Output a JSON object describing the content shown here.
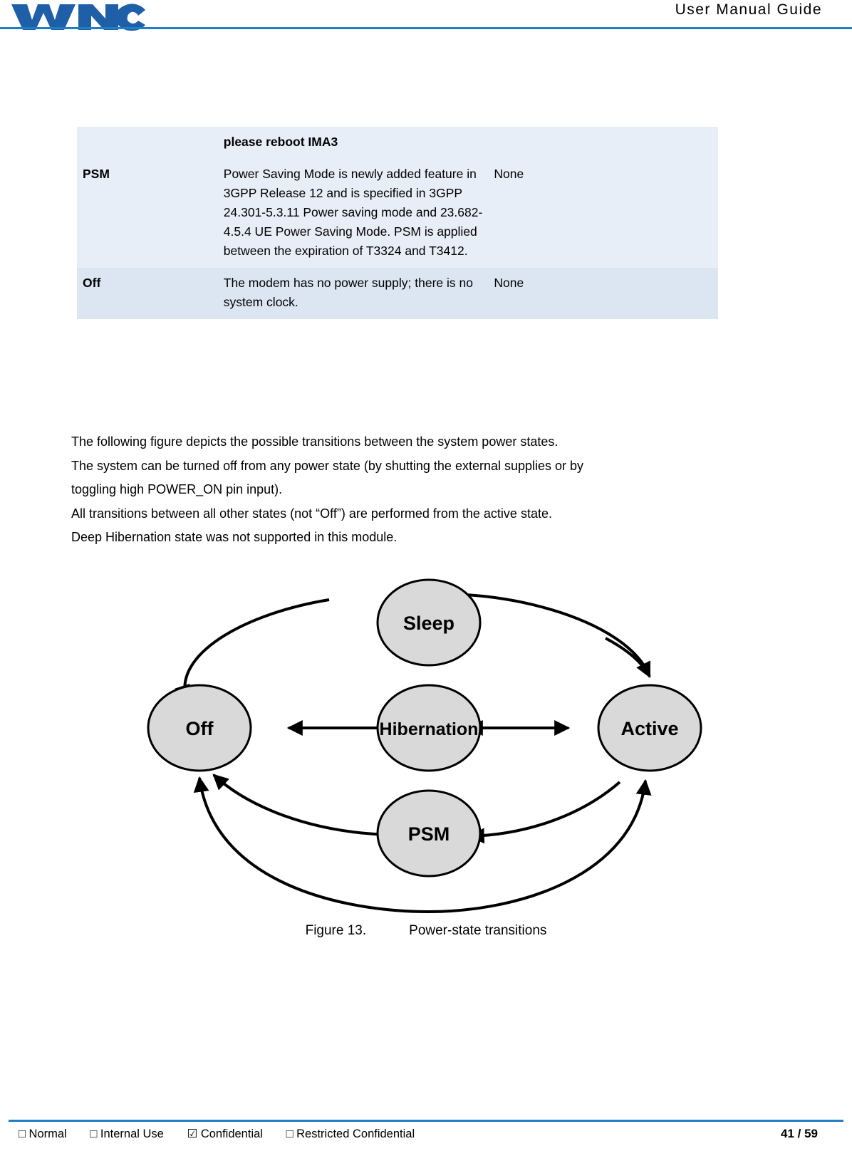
{
  "header": {
    "title": "User  Manual  Guide",
    "logo_text": "WNC"
  },
  "table": {
    "rows": [
      {
        "col1": "",
        "col2": "please reboot IMA3",
        "col2_bold": true,
        "col3": "",
        "shade": "row-a"
      },
      {
        "col1": "PSM",
        "col2": "Power Saving Mode is newly added feature in 3GPP Release 12 and is specified in 3GPP 24.301-5.3.11 Power saving mode and 23.682-4.5.4 UE Power Saving Mode. PSM is applied between the expiration of T3324 and T3412.",
        "col3": "None",
        "shade": "row-a"
      },
      {
        "col1": "Off",
        "col2": "The modem has no power supply; there is no system clock.",
        "col3": "None",
        "shade": "row-b"
      }
    ]
  },
  "body": {
    "lines": [
      "The following figure depicts the possible transitions between the system power states.",
      "The system can be turned off from any power state (by shutting the external supplies or by",
      "toggling high POWER_ON pin input).",
      "All transitions between all other states (not “Off”) are performed from the active state.",
      "Deep Hibernation state was not supported in this module."
    ]
  },
  "diagram": {
    "nodes": [
      {
        "id": "sleep",
        "label": "Sleep"
      },
      {
        "id": "off",
        "label": "Off"
      },
      {
        "id": "hibernation",
        "label": "Hibernation"
      },
      {
        "id": "active",
        "label": "Active"
      },
      {
        "id": "psm",
        "label": "PSM"
      }
    ],
    "node_fill": "#d9d9d9",
    "node_stroke": "#000000"
  },
  "figure": {
    "number": "Figure 13.",
    "caption": "Power-state transitions"
  },
  "footer": {
    "marks": [
      "□ Normal",
      "□ Internal Use",
      "☑ Confidential",
      "□ Restricted Confidential"
    ],
    "page": "41 / 59"
  }
}
